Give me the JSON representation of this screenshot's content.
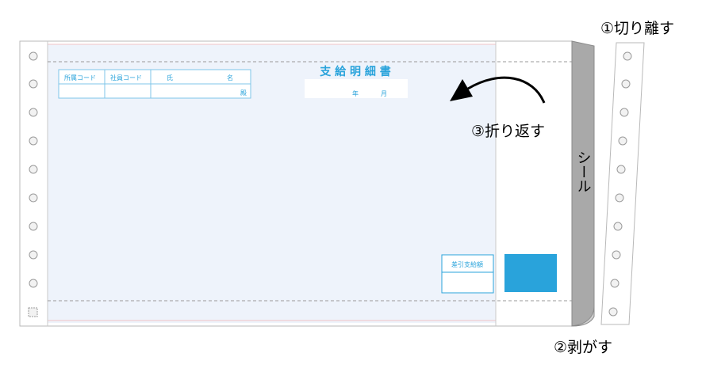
{
  "step_labels": {
    "cut": "①切り離す",
    "peel": "②剥がす",
    "fold": "③折り返す"
  },
  "seal_label": "シール",
  "form": {
    "title": "支 給 明 細 書",
    "table_headers": [
      "所属コード",
      "社員コード",
      "氏",
      "名"
    ],
    "honorific": "殿",
    "year": "年",
    "month": "月",
    "net_pay_label": "差引支給額"
  },
  "colors": {
    "form_tint": "#eef3fb",
    "text_blue": "#29a3db",
    "net_pay_box": "#29a3db",
    "seal_strip": "#a9a9a9",
    "guide_line": "#f2c3c6",
    "dashed": "#9a9a9a",
    "punch_hole": "#f2f2f2"
  },
  "icons": [
    "curved-arrow-icon",
    "punch-hole-icon"
  ]
}
